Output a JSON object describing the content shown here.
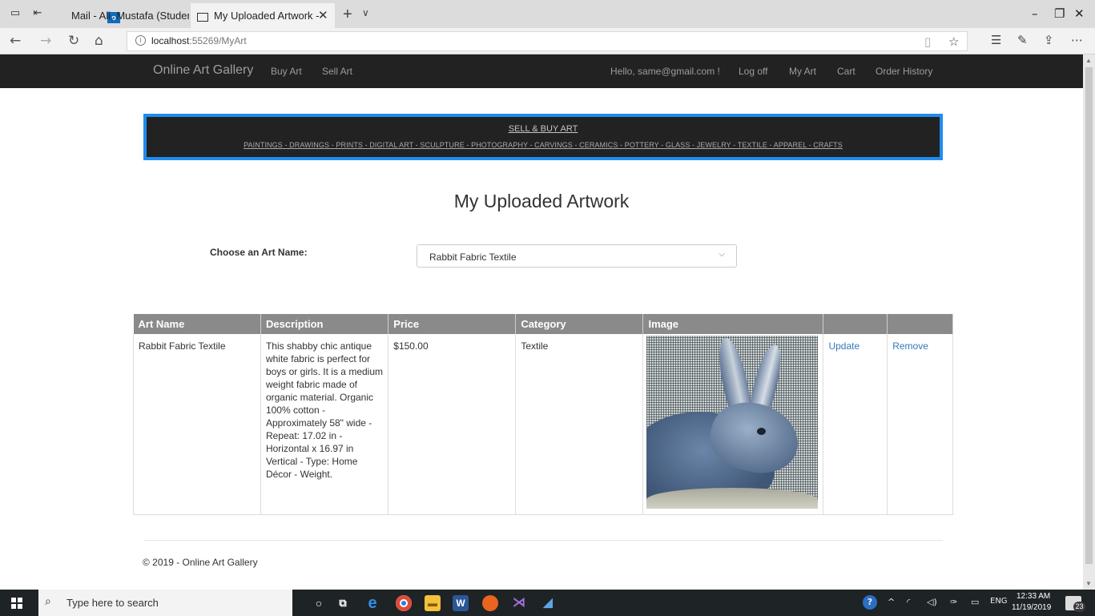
{
  "browser": {
    "tabs": [
      {
        "title": "Mail - Ali, Mustafa (Student)"
      },
      {
        "title": "My Uploaded Artwork -"
      }
    ],
    "url_host": "localhost",
    "url_rest": ":55269/MyArt"
  },
  "nav": {
    "brand": "Online Art Gallery",
    "left_links": [
      "Buy Art",
      "Sell Art"
    ],
    "greeting": "Hello, same@gmail.com !",
    "right_links": [
      "Log off",
      "My Art",
      "Cart",
      "Order History"
    ]
  },
  "banner": {
    "title": "SELL & BUY ART",
    "categories": "PAINTINGS - DRAWINGS - PRINTS - DIGITAL ART - SCULPTURE - PHOTOGRAPHY - CARVINGS - CERAMICS - POTTERY - GLASS - JEWELRY - TEXTILE - APPAREL - CRAFTS"
  },
  "page": {
    "heading": "My Uploaded Artwork",
    "choose_label": "Choose an Art Name:",
    "selected_art": "Rabbit Fabric Textile"
  },
  "table": {
    "headers": [
      "Art Name",
      "Description",
      "Price",
      "Category",
      "Image",
      "",
      ""
    ],
    "rows": [
      {
        "name": "Rabbit Fabric Textile",
        "description": "This shabby chic antique white fabric is perfect for boys or girls. It is a medium weight fabric made of organic material. Organic 100% cotton - Approximately 58\" wide - Repeat: 17.02 in - Horizontal x 16.97 in Vertical - Type: Home Décor - Weight.",
        "price": "$150.00",
        "category": "Textile",
        "update_label": "Update",
        "remove_label": "Remove"
      }
    ]
  },
  "footer": {
    "text": "© 2019 - Online Art Gallery"
  },
  "taskbar": {
    "search_placeholder": "Type here to search",
    "language": "ENG",
    "time": "12:33 AM",
    "date": "11/19/2019",
    "notification_count": "23"
  },
  "colors": {
    "navbar": "#222222",
    "banner_border": "#1f8cf0",
    "table_header": "#8a8a8a",
    "link": "#337ab7"
  }
}
